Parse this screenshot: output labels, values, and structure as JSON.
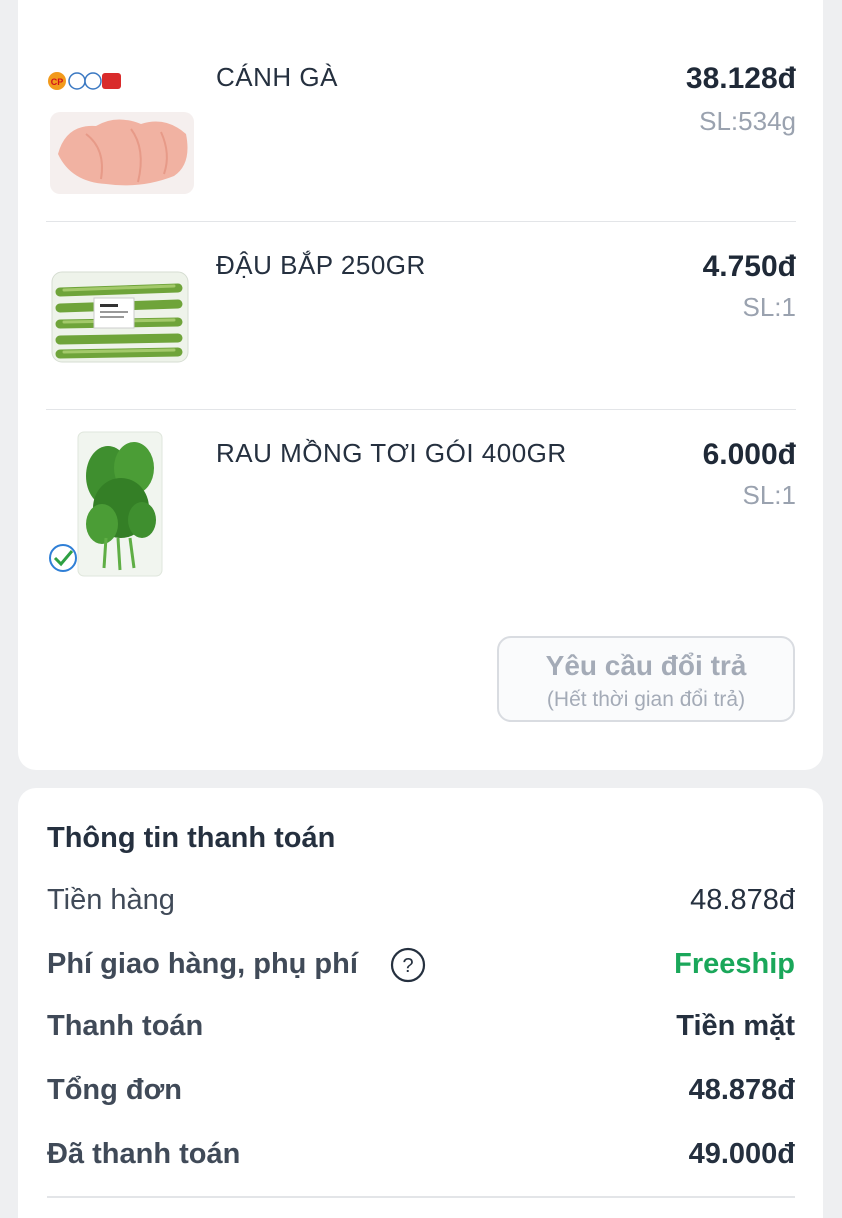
{
  "products": [
    {
      "name": "CÁNH GÀ",
      "price": "38.128đ",
      "qty": "SL:534g",
      "image": "chicken-wings-tray",
      "brand_logo": "CP"
    },
    {
      "name": "ĐẬU BẮP 250GR",
      "price": "4.750đ",
      "qty": "SL:1",
      "image": "okra-pack"
    },
    {
      "name": "RAU MỒNG TƠI GÓI 400GR",
      "price": "6.000đ",
      "qty": "SL:1",
      "image": "malabar-spinach-bag"
    }
  ],
  "return_request": {
    "title": "Yêu cầu đổi trả",
    "subtitle": "(Hết thời gian đổi trả)"
  },
  "payment": {
    "title": "Thông tin thanh toán",
    "rows": [
      {
        "label": "Tiền hàng",
        "value": "48.878đ"
      },
      {
        "label": "Phí giao hàng, phụ phí",
        "value": "Freeship",
        "icon": "question-circle-icon"
      },
      {
        "label": "Thanh toán",
        "value": "Tiền mặt"
      },
      {
        "label": "Tổng đơn",
        "value": "48.878đ"
      },
      {
        "label": "Đã thanh toán",
        "value": "49.000đ"
      }
    ]
  },
  "colors": {
    "accent_green": "#1aa75a",
    "text_dark": "#1f2937",
    "text_muted": "#9aa2af",
    "background": "#eeeff1"
  }
}
